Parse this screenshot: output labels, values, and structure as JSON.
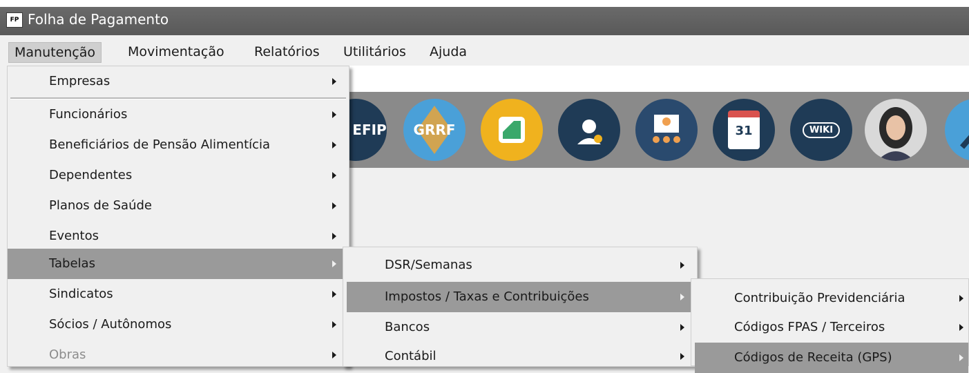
{
  "window": {
    "icon_text": "FP",
    "title": "Folha de Pagamento"
  },
  "menubar": {
    "items": [
      {
        "label": "Manutenção",
        "open": true
      },
      {
        "label": "Movimentação"
      },
      {
        "label": "Relatórios"
      },
      {
        "label": "Utilitários"
      },
      {
        "label": "Ajuda"
      }
    ]
  },
  "toolbar": {
    "buttons": [
      {
        "label": "EFIP",
        "icon": "sefip-icon",
        "color": "#1f3b56"
      },
      {
        "label": "GRRF",
        "icon": "grrf-icon",
        "color": "#4aa0d8"
      },
      {
        "label": "",
        "icon": "document-icon",
        "color": "#f0b21e"
      },
      {
        "label": "",
        "icon": "support-agent-icon",
        "color": "#1f3b56"
      },
      {
        "label": "",
        "icon": "meeting-icon",
        "color": "#2a4a6e"
      },
      {
        "label": "31",
        "icon": "calendar-icon",
        "color": "#1f3b56"
      },
      {
        "label": "WIKI",
        "icon": "wiki-icon",
        "color": "#1f3b56"
      },
      {
        "label": "",
        "icon": "assistant-avatar-icon",
        "color": "#d9d9d9"
      },
      {
        "label": "",
        "icon": "arrow-icon",
        "color": "#4aa0d8"
      }
    ]
  },
  "menu_manutencao": {
    "items": [
      {
        "label": "Empresas"
      },
      {
        "label": "Funcionários"
      },
      {
        "label": "Beneficiários de Pensão Alimentícia"
      },
      {
        "label": "Dependentes"
      },
      {
        "label": "Planos de Saúde"
      },
      {
        "label": "Eventos"
      },
      {
        "label": "Tabelas"
      },
      {
        "label": "Sindicatos"
      },
      {
        "label": "Sócios / Autônomos"
      },
      {
        "label": "Obras"
      }
    ]
  },
  "menu_tabelas": {
    "items": [
      {
        "label": "DSR/Semanas"
      },
      {
        "label": "Impostos / Taxas e Contribuições"
      },
      {
        "label": "Bancos"
      },
      {
        "label": "Contábil"
      }
    ]
  },
  "menu_impostos": {
    "items": [
      {
        "label": "Contribuição Previdenciária"
      },
      {
        "label": "Códigos FPAS / Terceiros"
      },
      {
        "label": "Códigos de Receita (GPS)"
      }
    ]
  }
}
